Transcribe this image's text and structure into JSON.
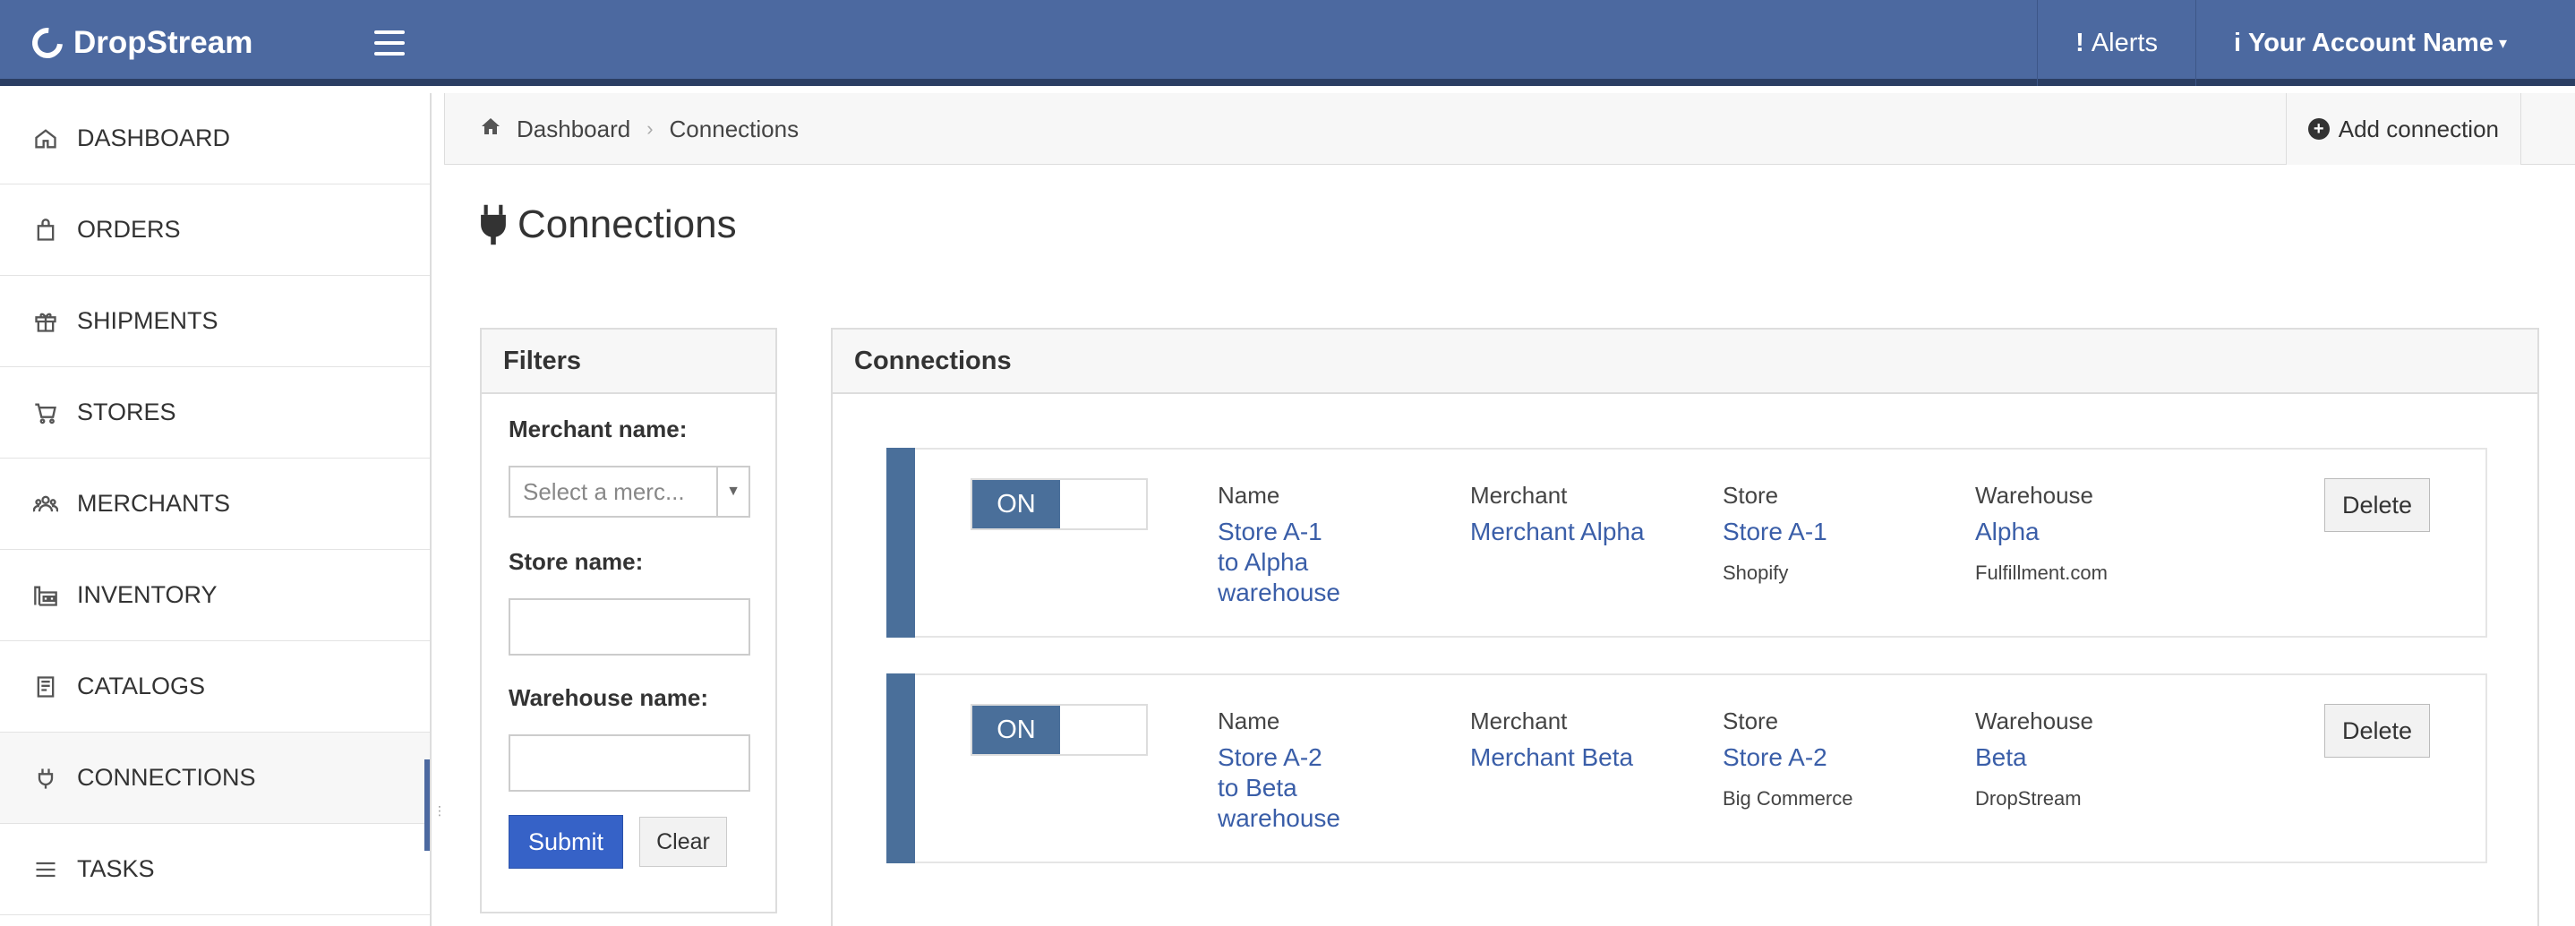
{
  "app": {
    "brand": "DropStream"
  },
  "header": {
    "alerts_label": "Alerts",
    "account_label": "Your Account Name"
  },
  "sidebar": {
    "items": [
      {
        "label": "DASHBOARD",
        "icon": "home-icon"
      },
      {
        "label": "ORDERS",
        "icon": "bag-icon"
      },
      {
        "label": "SHIPMENTS",
        "icon": "package-icon"
      },
      {
        "label": "STORES",
        "icon": "cart-icon"
      },
      {
        "label": "MERCHANTS",
        "icon": "users-icon"
      },
      {
        "label": "INVENTORY",
        "icon": "warehouse-icon"
      },
      {
        "label": "CATALOGS",
        "icon": "book-icon"
      },
      {
        "label": "CONNECTIONS",
        "icon": "plug-icon",
        "active": true
      },
      {
        "label": "TASKS",
        "icon": "list-icon"
      }
    ]
  },
  "breadcrumb": {
    "home": "Dashboard",
    "current": "Connections"
  },
  "actions": {
    "add_connection": "Add connection"
  },
  "page": {
    "title": "Connections"
  },
  "filters": {
    "title": "Filters",
    "merchant_label": "Merchant name:",
    "merchant_placeholder": "Select a merc...",
    "store_label": "Store name:",
    "warehouse_label": "Warehouse name:",
    "submit_label": "Submit",
    "clear_label": "Clear"
  },
  "connections": {
    "title": "Connections",
    "col_name": "Name",
    "col_merchant": "Merchant",
    "col_store": "Store",
    "col_warehouse": "Warehouse",
    "toggle_on": "ON",
    "delete_label": "Delete",
    "rows": [
      {
        "name_lines": [
          "Store A-1",
          "to Alpha",
          "warehouse"
        ],
        "merchant": "Merchant Alpha",
        "store": "Store A-1",
        "store_platform": "Shopify",
        "warehouse": "Alpha",
        "warehouse_provider": "Fulfillment.com"
      },
      {
        "name_lines": [
          "Store A-2",
          "to Beta",
          "warehouse"
        ],
        "merchant": "Merchant Beta",
        "store": "Store A-2",
        "store_platform": "Big Commerce",
        "warehouse": "Beta",
        "warehouse_provider": "DropStream"
      }
    ]
  },
  "colors": {
    "navbar": "#4c69a0",
    "accent": "#4a6f9a",
    "link": "#3a5ea8",
    "submit": "#3662c7"
  }
}
